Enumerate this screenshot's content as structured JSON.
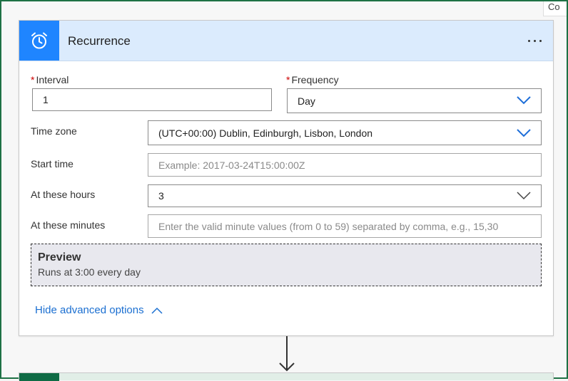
{
  "corner_label": "Co",
  "card": {
    "title": "Recurrence",
    "icon": "alarm-clock-icon",
    "accent_color": "#1f85ff",
    "header_bg": "#dbebfd"
  },
  "fields": {
    "interval": {
      "required": "*",
      "label": "Interval",
      "value": "1"
    },
    "frequency": {
      "required": "*",
      "label": "Frequency",
      "value": "Day"
    },
    "timezone": {
      "label": "Time zone",
      "value": "(UTC+00:00) Dublin, Edinburgh, Lisbon, London"
    },
    "start_time": {
      "label": "Start time",
      "placeholder": "Example: 2017-03-24T15:00:00Z"
    },
    "hours": {
      "label": "At these hours",
      "value": "3"
    },
    "minutes": {
      "label": "At these minutes",
      "placeholder": "Enter the valid minute values (from 0 to 59) separated by comma, e.g., 15,30"
    }
  },
  "preview": {
    "title": "Preview",
    "text": "Runs at 3:00 every day"
  },
  "advanced_link": "Hide advanced options"
}
